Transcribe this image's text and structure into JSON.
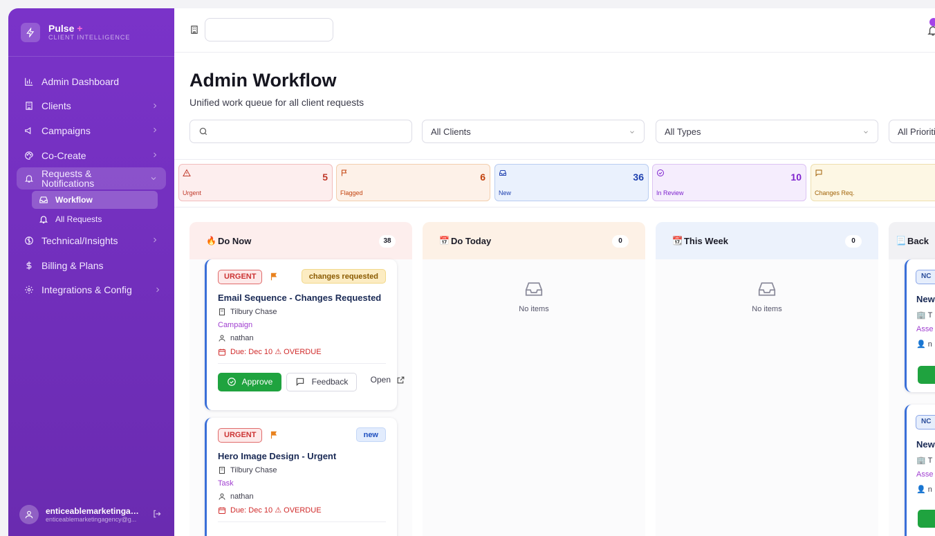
{
  "brand": {
    "name": "Pulse",
    "plus": "+",
    "subtitle": "CLIENT INTELLIGENCE"
  },
  "sidebar": {
    "items": [
      {
        "label": "Admin Dashboard",
        "icon": "chart-icon"
      },
      {
        "label": "Clients",
        "icon": "building-icon"
      },
      {
        "label": "Campaigns",
        "icon": "megaphone-icon"
      },
      {
        "label": "Co-Create",
        "icon": "palette-icon"
      },
      {
        "label": "Requests & Notifications",
        "icon": "bell-icon"
      },
      {
        "label": "Technical/Insights",
        "icon": "compass-icon"
      },
      {
        "label": "Billing & Plans",
        "icon": "dollar-icon"
      },
      {
        "label": "Integrations & Config",
        "icon": "gear-icon"
      }
    ],
    "sub_items": [
      {
        "label": "Workflow",
        "icon": "inbox-icon"
      },
      {
        "label": "All Requests",
        "icon": "bell-icon"
      }
    ]
  },
  "user": {
    "name": "enticeablemarketingage...",
    "email": "enticeablemarketingagency@g..."
  },
  "page": {
    "title": "Admin Workflow",
    "subtitle": "Unified work queue for all client requests"
  },
  "filters": {
    "clients": "All Clients",
    "types": "All Types",
    "priorities": "All Prioriti"
  },
  "stats": [
    {
      "label": "Urgent",
      "value": "5",
      "color": "#c0392b"
    },
    {
      "label": "Flagged",
      "value": "6",
      "color": "#c2410c"
    },
    {
      "label": "New",
      "value": "36",
      "color": "#1e40af"
    },
    {
      "label": "In Review",
      "value": "10",
      "color": "#7e22ce"
    },
    {
      "label": "Changes Req.",
      "value": "",
      "color": "#a16207"
    }
  ],
  "columns": [
    {
      "emoji": "🔥",
      "title": "Do Now",
      "count": "38"
    },
    {
      "emoji": "📅",
      "title": "Do Today",
      "count": "0",
      "empty": "No items"
    },
    {
      "emoji": "📆",
      "title": "This Week",
      "count": "0",
      "empty": "No items"
    },
    {
      "emoji": "📃",
      "title": "Back"
    }
  ],
  "cards": [
    {
      "priority": "URGENT",
      "status": "changes requested",
      "title": "Email Sequence - Changes Requested",
      "client": "Tilbury Chase",
      "type": "Campaign",
      "assignee": "nathan",
      "due": "Due: Dec 10",
      "overdue": "⚠ OVERDUE",
      "approve": "Approve",
      "feedback": "Feedback",
      "open": "Open"
    },
    {
      "priority": "URGENT",
      "status": "new",
      "title": "Hero Image Design - Urgent",
      "client": "Tilbury Chase",
      "type": "Task",
      "assignee": "nathan",
      "due": "Due: Dec 10",
      "overdue": "⚠ OVERDUE"
    }
  ],
  "backlog_peek": [
    {
      "tag": "NC",
      "title": "New",
      "client": "T",
      "type": "Asse",
      "assignee": "n"
    },
    {
      "tag": "NC",
      "title": "New",
      "client": "T",
      "type": "Asse",
      "assignee": "n"
    }
  ]
}
